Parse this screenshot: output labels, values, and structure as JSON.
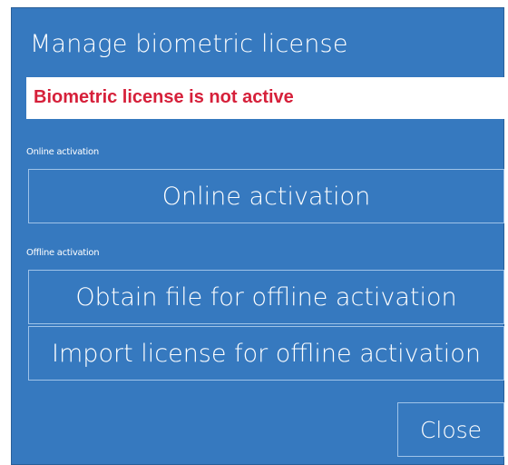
{
  "dialog": {
    "title": "Manage biometric license",
    "status_text": "Biometric license is not active",
    "online_section_label": "Online activation",
    "online_button_label": "Online activation",
    "offline_section_label": "Offline activation",
    "obtain_file_button_label": "Obtain file for offline activation",
    "import_license_button_label": "Import license for offline activation",
    "close_button_label": "Close"
  },
  "colors": {
    "background": "#3679bf",
    "status_text": "#d6203a",
    "button_border": "#9fc3e8"
  }
}
